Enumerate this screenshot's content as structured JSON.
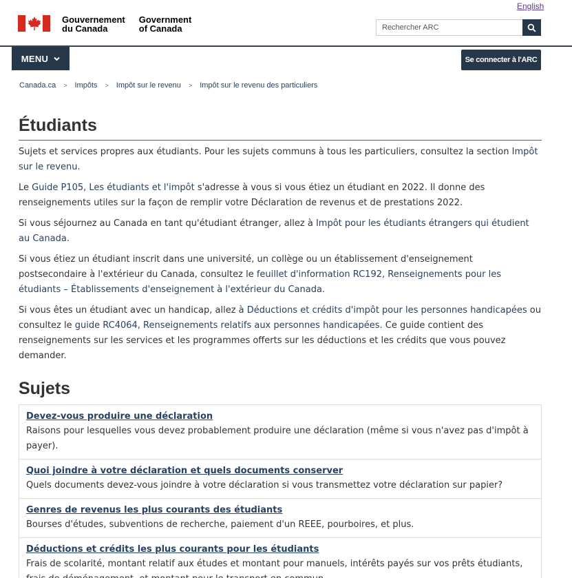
{
  "header": {
    "language_link": "English",
    "signature_fr": [
      "Gouvernement",
      "du Canada"
    ],
    "signature_en": [
      "Government",
      "of Canada"
    ],
    "search_placeholder": "Rechercher ARC",
    "menu_label": "MENU",
    "signin_label": "Se connecter à l'ARC"
  },
  "breadcrumb": [
    "Canada.ca",
    "Impôts",
    "Impôt sur le revenu",
    "Impôt sur le revenu des particuliers"
  ],
  "page": {
    "title": "Étudiants",
    "p1_text": "Sujets et services propres aux étudiants. Pour les sujets communs à tous les particuliers, consultez la section ",
    "p1_link": "Impôt sur le revenu",
    "p1_end": ".",
    "p2_pre": "Le ",
    "p2_link": "Guide P105, Les étudiants et l'impôt",
    "p2_text": " s'adresse à vous si vous étiez un étudiant en 2022. Il donne des renseignements utiles sur la façon de remplir votre Déclaration de revenus et de prestations 2022.",
    "p3_text": "Si vous séjournez au Canada en tant qu'étudiant étranger, allez à ",
    "p3_link": "Impôt pour les étudiants étrangers qui étudient au Canada",
    "p3_end": ".",
    "p4_text": "Si vous étiez un étudiant inscrit dans une université, un collège ou un établissement d'enseignement postsecondaire à l'extérieur du Canada, consultez le ",
    "p4_link": "feuillet d'information RC192, Renseignements pour les étudiants – Établissements d'enseignement à l'extérieur du Canada",
    "p4_end": ".",
    "p5_text": "Si vous êtes un étudiant avec un handicap, allez à ",
    "p5_link1": "Déductions et crédits d'impôt pour les personnes handicapées",
    "p5_mid": " ou consultez le ",
    "p5_link2": "guide RC4064, Renseignements relatifs aux personnes handicapées",
    "p5_end": ". Ce guide contient des renseignements sur les services et les programmes offerts sur les déductions et les crédits que vous pouvez demander."
  },
  "topics_heading": "Sujets",
  "topics": [
    {
      "title": "Devez-vous produire une déclaration",
      "desc": "Raisons pour lesquelles vous devez probablement produire une déclaration (même si vous n'avez pas d'impôt à payer)."
    },
    {
      "title": "Quoi joindre à votre déclaration et quels documents conserver",
      "desc": "Quels documents devez-vous joindre à votre déclaration si vous transmettez votre déclaration sur papier?"
    },
    {
      "title": "Genres de revenus les plus courants des étudiants",
      "desc": "Bourses d'études, subventions de recherche, paiement d'un REEE, pourboires, et plus."
    },
    {
      "title": "Déductions et crédits les plus courants pour les étudiants",
      "desc": "Frais de scolarité, montant relatif aux études et montant pour manuels, intérêts payés sur vos prêts étudiants, frais de déménagement, et montant pour le transport en commun."
    }
  ],
  "colors": {
    "navy": "#26374a",
    "link": "#284162",
    "visited_link": "#5a3b8a",
    "flag_red": "#d52b1e",
    "title_rule": "#af3c43"
  }
}
